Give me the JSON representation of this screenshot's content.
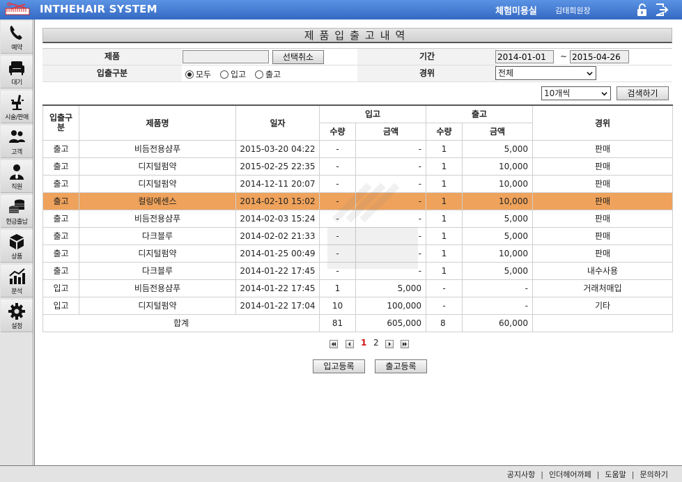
{
  "header": {
    "app_title": "INTHEHAIR SYSTEM",
    "salon_name": "체험미용실",
    "user_name": "김태희원장",
    "lock_icon": "lock-icon",
    "logout_icon": "logout-icon"
  },
  "sidebar": {
    "items": [
      {
        "label": "예약",
        "icon": "phone-icon"
      },
      {
        "label": "대기",
        "icon": "sofa-icon"
      },
      {
        "label": "시술/판매",
        "icon": "salon-chair-icon"
      },
      {
        "label": "고객",
        "icon": "customers-icon"
      },
      {
        "label": "직원",
        "icon": "staff-icon"
      },
      {
        "label": "현금출납",
        "icon": "coins-icon"
      },
      {
        "label": "상품",
        "icon": "products-icon"
      },
      {
        "label": "분석",
        "icon": "chart-icon"
      },
      {
        "label": "설정",
        "icon": "gear-icon"
      }
    ]
  },
  "page": {
    "title": "제품입출고내역"
  },
  "filter": {
    "product_label": "제품",
    "product_value": "",
    "clear_button": "선택취소",
    "period_label": "기간",
    "date_from": "2014-01-01",
    "date_sep": "~",
    "date_to": "2015-04-26",
    "type_label": "입출구분",
    "type_options": [
      "모두",
      "입고",
      "출고"
    ],
    "type_selected": "모두",
    "reason_label": "경위",
    "reason_selected": "전체",
    "page_size": "10개씩",
    "search_button": "검색하기"
  },
  "table": {
    "headers": {
      "type": "입출구분",
      "name": "제품명",
      "date": "일자",
      "in": "입고",
      "out": "출고",
      "qty": "수량",
      "amount": "금액",
      "reason": "경위"
    },
    "rows": [
      {
        "type": "출고",
        "name": "비듬전용샴푸",
        "date": "2015-03-20 04:22",
        "in_qty": "-",
        "in_amt": "-",
        "out_qty": "1",
        "out_amt": "5,000",
        "reason": "판매"
      },
      {
        "type": "출고",
        "name": "디지털펌약",
        "date": "2015-02-25 22:35",
        "in_qty": "-",
        "in_amt": "-",
        "out_qty": "1",
        "out_amt": "10,000",
        "reason": "판매"
      },
      {
        "type": "출고",
        "name": "디지털펌약",
        "date": "2014-12-11 20:07",
        "in_qty": "-",
        "in_amt": "-",
        "out_qty": "1",
        "out_amt": "10,000",
        "reason": "판매"
      },
      {
        "type": "출고",
        "name": "컬링에센스",
        "date": "2014-02-10 15:02",
        "in_qty": "-",
        "in_amt": "-",
        "out_qty": "1",
        "out_amt": "10,000",
        "reason": "판매",
        "selected": true
      },
      {
        "type": "출고",
        "name": "비듬전용샴푸",
        "date": "2014-02-03 15:24",
        "in_qty": "-",
        "in_amt": "-",
        "out_qty": "1",
        "out_amt": "5,000",
        "reason": "판매"
      },
      {
        "type": "출고",
        "name": "다크블루",
        "date": "2014-02-02 21:33",
        "in_qty": "-",
        "in_amt": "-",
        "out_qty": "1",
        "out_amt": "5,000",
        "reason": "판매"
      },
      {
        "type": "출고",
        "name": "디지털펌약",
        "date": "2014-01-25 00:49",
        "in_qty": "-",
        "in_amt": "-",
        "out_qty": "1",
        "out_amt": "10,000",
        "reason": "판매"
      },
      {
        "type": "출고",
        "name": "다크블루",
        "date": "2014-01-22 17:45",
        "in_qty": "-",
        "in_amt": "-",
        "out_qty": "1",
        "out_amt": "5,000",
        "reason": "내수사용"
      },
      {
        "type": "입고",
        "name": "비듬전용샴푸",
        "date": "2014-01-22 17:45",
        "in_qty": "1",
        "in_amt": "5,000",
        "out_qty": "-",
        "out_amt": "-",
        "reason": "거래처매입"
      },
      {
        "type": "입고",
        "name": "디지털펌약",
        "date": "2014-01-22 17:04",
        "in_qty": "10",
        "in_amt": "100,000",
        "out_qty": "-",
        "out_amt": "-",
        "reason": "기타"
      }
    ],
    "total": {
      "label": "합계",
      "in_qty": "81",
      "in_amt": "605,000",
      "out_qty": "8",
      "out_amt": "60,000"
    }
  },
  "pagination": {
    "pages": [
      "1",
      "2"
    ],
    "current": "1"
  },
  "actions": {
    "stock_in": "입고등록",
    "stock_out": "출고등록"
  },
  "footer": {
    "links": [
      "공지사항",
      "인더헤어까페",
      "도움말",
      "문의하기"
    ],
    "separator": "|"
  },
  "colors": {
    "header": "#3f78d0",
    "selected_row": "#eea25b",
    "current_page": "#d01010"
  }
}
